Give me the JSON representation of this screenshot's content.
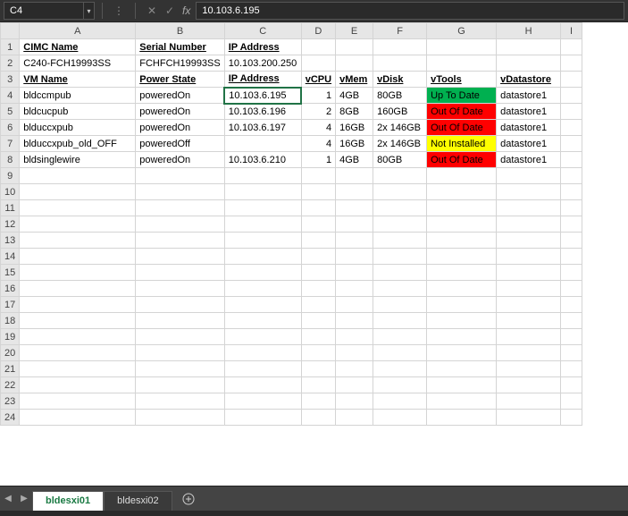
{
  "namebox": "C4",
  "formula": "10.103.6.195",
  "columns": [
    "A",
    "B",
    "C",
    "D",
    "E",
    "F",
    "G",
    "H",
    "I"
  ],
  "row_count": 24,
  "selected": {
    "row": 4,
    "col": "C"
  },
  "chart_data": {
    "type": "table",
    "headers_row1": [
      "CIMC Name",
      "Serial Number",
      "IP Address",
      "",
      "",
      "",
      "",
      "",
      ""
    ],
    "row2": [
      "C240-FCH19993SS",
      "FCHFCH19993SS",
      "10.103.200.250",
      "",
      "",
      "",
      "",
      "",
      ""
    ],
    "headers_row3": [
      "VM Name",
      "Power State",
      "IP Address",
      "vCPU",
      "vMem",
      "vDisk",
      "vTools",
      "vDatastore",
      ""
    ],
    "data_rows": [
      {
        "r": 4,
        "cells": [
          "bldccmpub",
          "poweredOn",
          "10.103.6.195",
          "1",
          "4GB",
          "80GB",
          "Up To Date",
          "datastore1",
          ""
        ],
        "status": "green"
      },
      {
        "r": 5,
        "cells": [
          "bldcucpub",
          "poweredOn",
          "10.103.6.196",
          "2",
          "8GB",
          "160GB",
          "Out Of Date",
          "datastore1",
          ""
        ],
        "status": "red"
      },
      {
        "r": 6,
        "cells": [
          "blduccxpub",
          "poweredOn",
          "10.103.6.197",
          "4",
          "16GB",
          "2x 146GB",
          "Out Of Date",
          "datastore1",
          ""
        ],
        "status": "red"
      },
      {
        "r": 7,
        "cells": [
          "blduccxpub_old_OFF",
          "poweredOff",
          "",
          "4",
          "16GB",
          "2x 146GB",
          "Not Installed",
          "datastore1",
          ""
        ],
        "status": "yellow"
      },
      {
        "r": 8,
        "cells": [
          "bldsinglewire",
          "poweredOn",
          "10.103.6.210",
          "1",
          "4GB",
          "80GB",
          "Out Of Date",
          "datastore1",
          ""
        ],
        "status": "red"
      }
    ]
  },
  "tabs": [
    {
      "label": "bldesxi01",
      "active": true
    },
    {
      "label": "bldesxi02",
      "active": false
    }
  ],
  "icons": {
    "dots": "⋮",
    "cancel": "✕",
    "confirm": "✓",
    "fx": "fx",
    "nav_prev": "◀",
    "nav_next": "▶"
  }
}
